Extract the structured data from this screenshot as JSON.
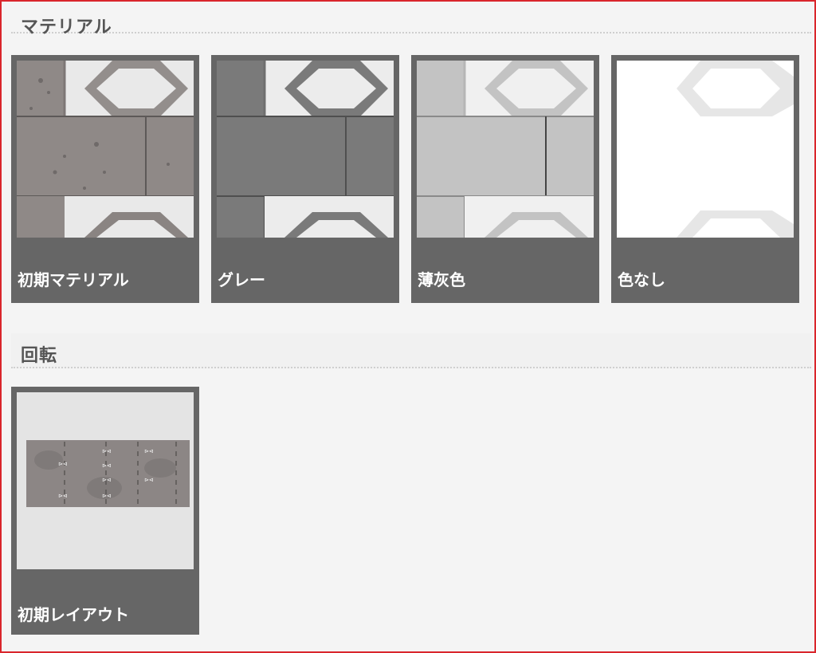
{
  "material_section": {
    "title": "マテリアル",
    "cards": [
      {
        "label": "初期マテリアル",
        "swatch": "#8a8482",
        "stripe": "#7d7776",
        "icon": "concrete-texture-icon"
      },
      {
        "label": "グレー",
        "swatch": "#7a7a7a",
        "stripe": "#6f6f6f",
        "icon": "gray-texture-icon"
      },
      {
        "label": "薄灰色",
        "swatch": "#c3c3c3",
        "stripe": "#b6b6b6",
        "icon": "light-gray-texture-icon"
      },
      {
        "label": "色なし",
        "swatch": "#ffffff",
        "stripe": "#e6e6e6",
        "icon": "no-color-texture-icon"
      }
    ]
  },
  "rotation_section": {
    "title": "回転",
    "cards": [
      {
        "label": "初期レイアウト",
        "icon": "initial-layout-icon"
      }
    ]
  },
  "colors": {
    "frame": "#d9262c",
    "card_bg": "#666666",
    "page_bg": "#f4f4f4"
  }
}
